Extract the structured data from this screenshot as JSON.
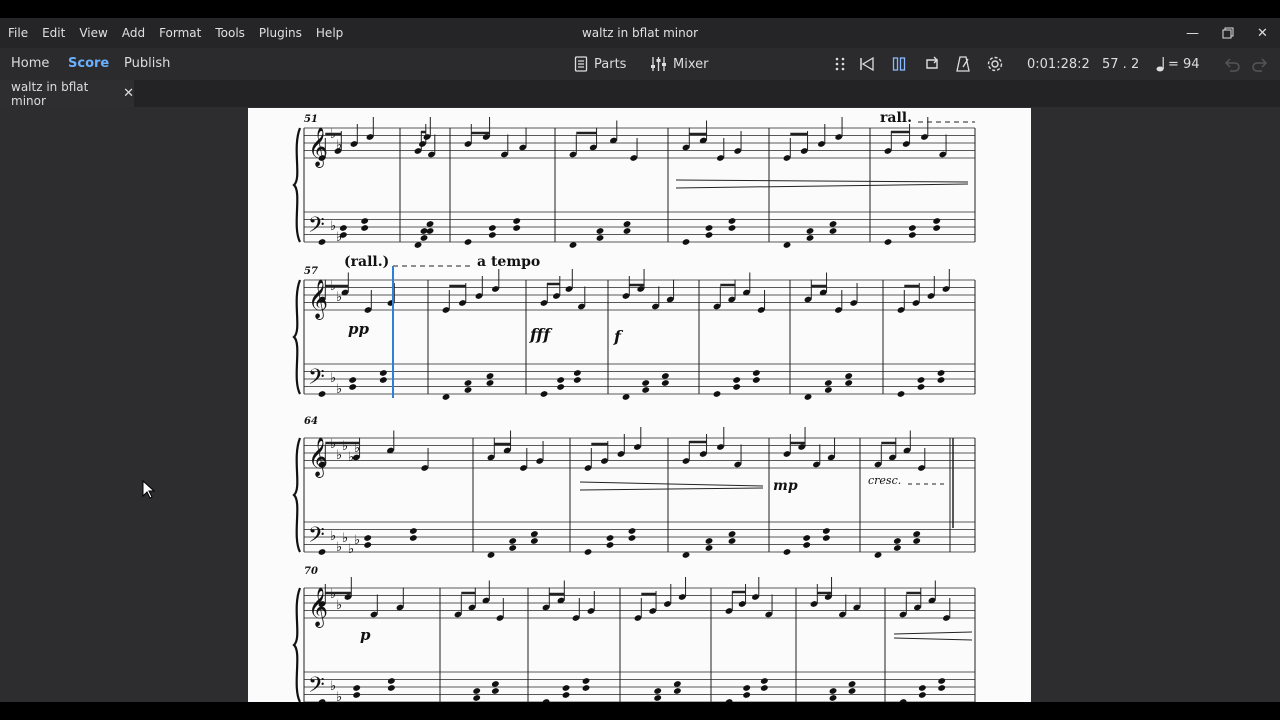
{
  "menu": [
    "File",
    "Edit",
    "View",
    "Add",
    "Format",
    "Tools",
    "Plugins",
    "Help"
  ],
  "window": {
    "title": "waltz in bflat minor"
  },
  "nav_tabs": {
    "home": "Home",
    "score": "Score",
    "publish": "Publish"
  },
  "toolbar": {
    "parts": "Parts",
    "mixer": "Mixer",
    "time": "0:01:28:2",
    "position": "57 . 2",
    "tempo": "= 94"
  },
  "document_tab": {
    "label": "waltz in bflat minor"
  },
  "score": {
    "measure_numbers": [
      "51",
      "57",
      "64",
      "70"
    ],
    "tempo_marks": {
      "rall": "rall.",
      "rall_paren": "(rall.)",
      "a_tempo": "a tempo"
    },
    "dynamics": {
      "pp": "pp",
      "fff": "fff",
      "f": "f",
      "mp": "mp",
      "cresc": "cresc.",
      "p": "p"
    }
  }
}
